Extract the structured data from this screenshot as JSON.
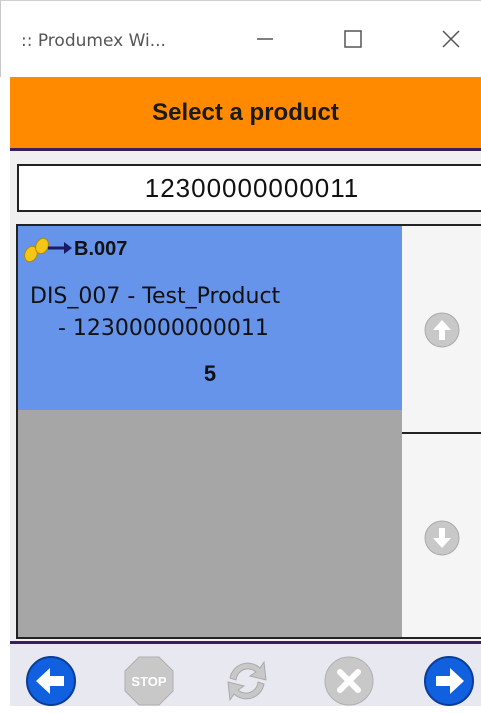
{
  "window": {
    "title": ":: Produmex Wi...",
    "minimize_icon": "minimize-icon",
    "maximize_icon": "maximize-icon",
    "close_icon": "close-icon"
  },
  "header": {
    "title": "Select a product"
  },
  "search": {
    "value": "12300000000011"
  },
  "list": {
    "items": [
      {
        "location_icon": "footsteps-arrow-icon",
        "location": "B.007",
        "line1": "DIS_007 - Test_Product",
        "line2": "- 12300000000011",
        "quantity": "5"
      }
    ]
  },
  "scroll": {
    "up_icon": "scroll-up-icon",
    "down_icon": "scroll-down-icon"
  },
  "footer": {
    "buttons": [
      "back-icon",
      "stop-icon",
      "refresh-icon",
      "cancel-icon",
      "forward-icon"
    ],
    "stop_label": "STOP"
  },
  "colors": {
    "header_bg": "#ff8a00",
    "item_selected_bg": "#6594ea",
    "list_bg": "#a6a6a6",
    "nav_blue": "#1060e0"
  }
}
